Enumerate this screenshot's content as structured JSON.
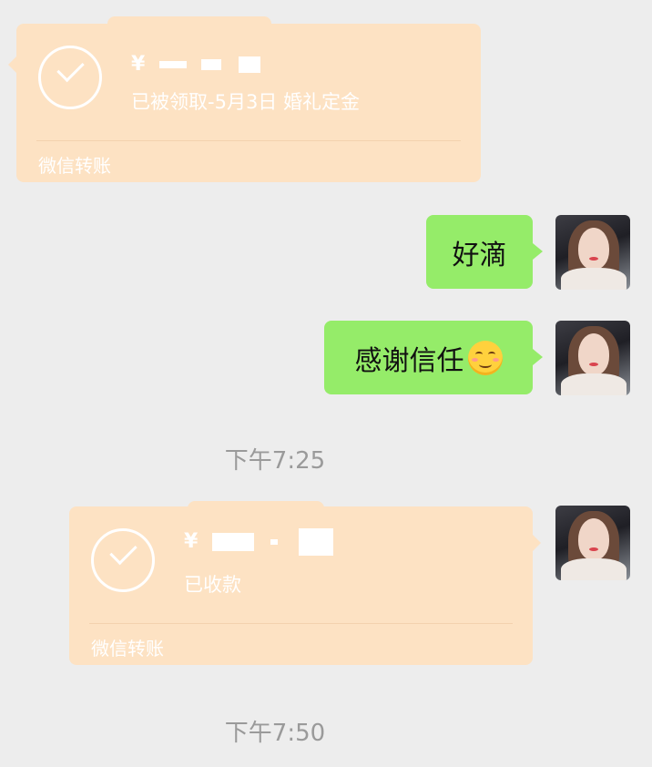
{
  "messages": {
    "transfer_top": {
      "amount_masked": "¥",
      "status": "已被领取-5月3日 婚礼定金",
      "footer": "微信转账"
    },
    "msg_1": "好滴",
    "msg_2": "感谢信任",
    "timestamp_1": "下午7:25",
    "transfer_bottom": {
      "amount_masked": "¥",
      "status": "已收款",
      "footer": "微信转账"
    },
    "timestamp_2": "下午7:50"
  },
  "colors": {
    "background": "#ededed",
    "transfer_card": "#fde2c3",
    "sent_bubble": "#95ec69",
    "timestamp": "#9a9a9a"
  }
}
